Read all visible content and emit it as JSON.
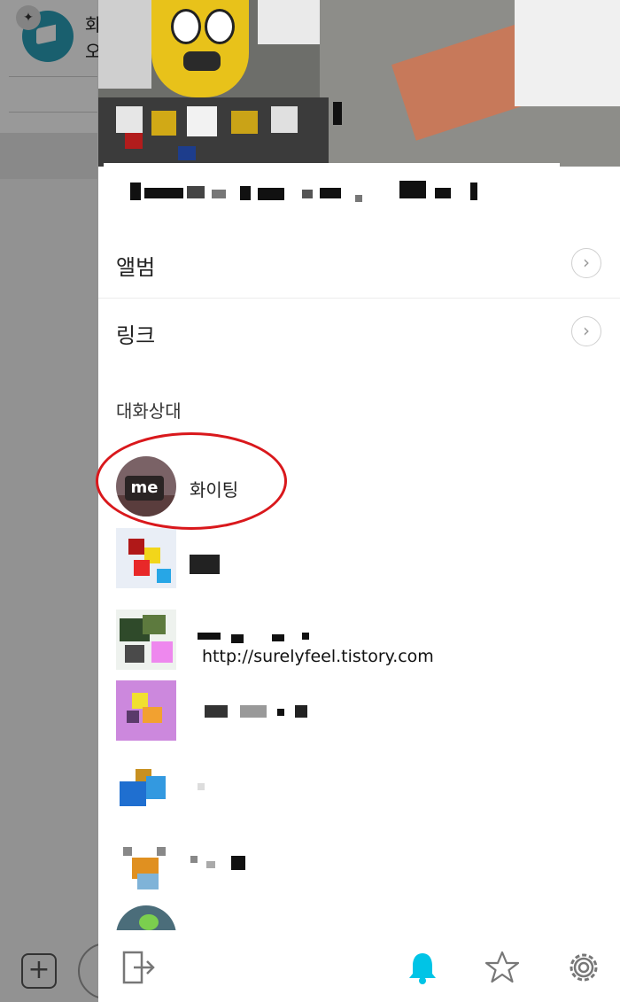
{
  "background_chat": {
    "row_text_line1": "화",
    "row_text_line2": "오"
  },
  "drawer": {
    "menu": [
      {
        "label": "앨범"
      },
      {
        "label": "링크"
      }
    ],
    "section_title": "대화상대",
    "members": [
      {
        "name": "화이팅",
        "is_me": true,
        "me_badge": "me"
      }
    ],
    "watermark": "http://surelyfeel.tistory.com"
  },
  "bottom_bar": {
    "icons": [
      "exit-icon",
      "bell-icon",
      "star-icon",
      "gear-icon"
    ],
    "active_color": "#00c4e6"
  },
  "colors": {
    "highlight_circle": "#d9181c",
    "background_avatar": "#2a9fb8"
  }
}
